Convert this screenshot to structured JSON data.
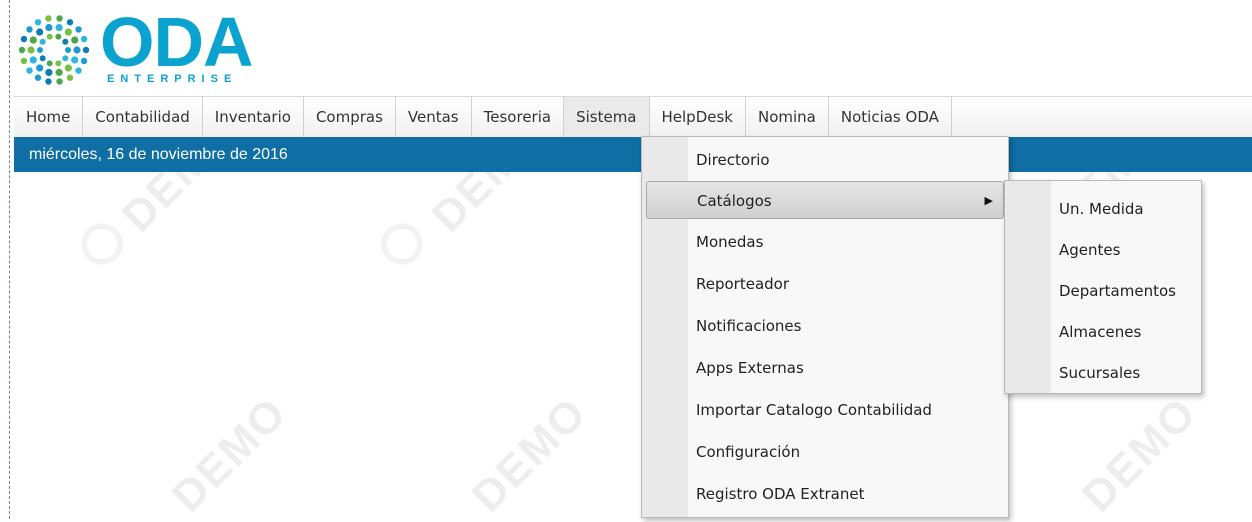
{
  "logo": {
    "text": "ODA",
    "subtext": "ENTERPRISE"
  },
  "watermark": {
    "text": "DEMO"
  },
  "menubar": {
    "items": [
      {
        "label": "Home"
      },
      {
        "label": "Contabilidad"
      },
      {
        "label": "Inventario"
      },
      {
        "label": "Compras"
      },
      {
        "label": "Ventas"
      },
      {
        "label": "Tesoreria"
      },
      {
        "label": "Sistema"
      },
      {
        "label": "HelpDesk"
      },
      {
        "label": "Nomina"
      },
      {
        "label": "Noticias ODA"
      }
    ],
    "active": "Sistema"
  },
  "datebar": {
    "text": "miércoles, 16 de noviembre de 2016"
  },
  "sistema_menu": {
    "items": [
      {
        "label": "Directorio"
      },
      {
        "label": "Catálogos",
        "has_submenu": true
      },
      {
        "label": "Monedas"
      },
      {
        "label": "Reporteador"
      },
      {
        "label": "Notificaciones"
      },
      {
        "label": "Apps Externas"
      },
      {
        "label": "Importar Catalogo Contabilidad"
      },
      {
        "label": "Configuración"
      },
      {
        "label": "Registro ODA Extranet"
      }
    ],
    "submenu_arrow": "▶"
  },
  "catalogos_submenu": {
    "items": [
      {
        "label": "Un. Medida"
      },
      {
        "label": "Agentes"
      },
      {
        "label": "Departamentos"
      },
      {
        "label": "Almacenes"
      },
      {
        "label": "Sucursales"
      }
    ]
  },
  "colors": {
    "brand": "#0aa3cf",
    "datebar": "#0f6ea3"
  }
}
